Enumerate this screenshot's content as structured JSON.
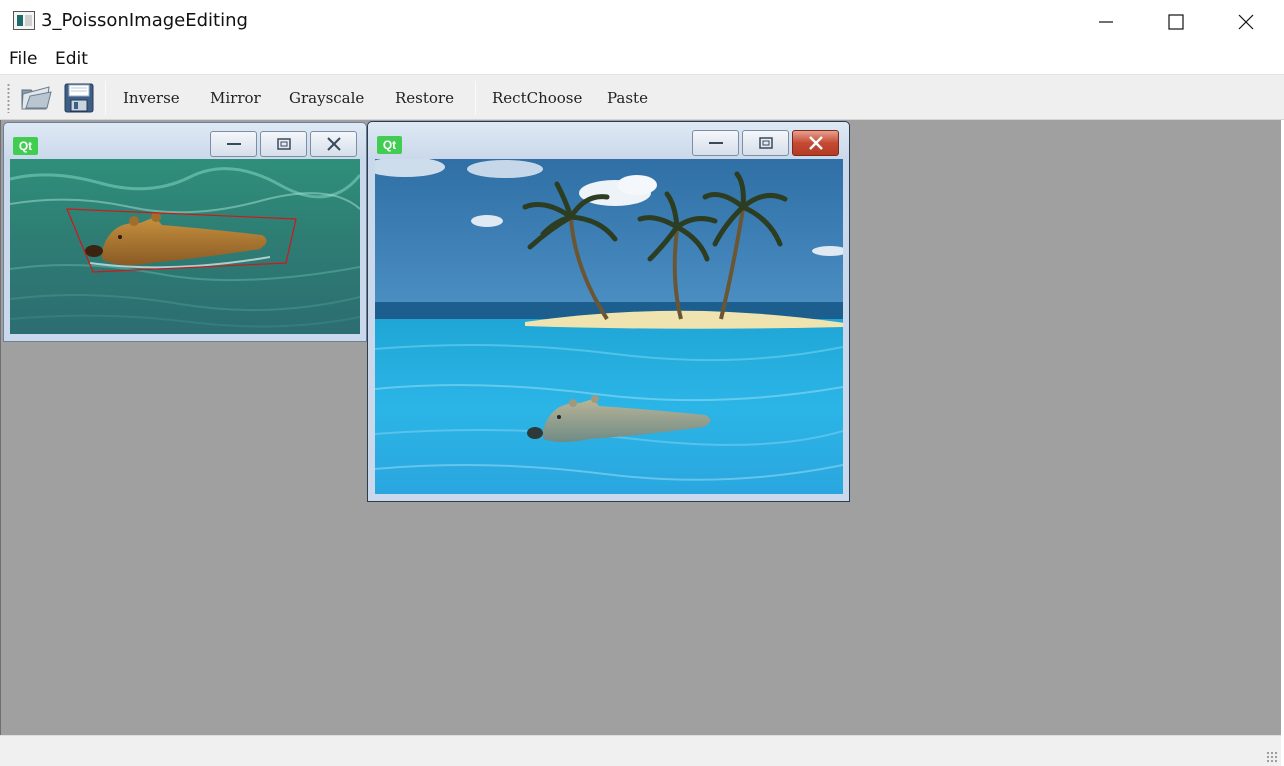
{
  "window": {
    "title": "3_PoissonImageEditing",
    "controls": {
      "minimize": "minimize-icon",
      "maximize": "maximize-icon",
      "close": "close-icon"
    }
  },
  "menubar": {
    "items": [
      {
        "label": "File"
      },
      {
        "label": "Edit"
      }
    ]
  },
  "toolbar": {
    "icons": [
      {
        "name": "open-folder-icon"
      },
      {
        "name": "save-disk-icon"
      }
    ],
    "actions": {
      "inverse": "Inverse",
      "mirror": "Mirror",
      "grayscale": "Grayscale",
      "restore": "Restore",
      "rect_choose": "RectChoose",
      "paste": "Paste"
    }
  },
  "sub_windows": [
    {
      "badge": "Qt",
      "image": "source image: bear swimming in green water with red polygon selection",
      "active": false
    },
    {
      "badge": "Qt",
      "image": "target image: tropical island with palm trees and pasted bear in blue water",
      "active": true
    }
  ],
  "colors": {
    "mdi_background": "#a0a0a0",
    "qt_green": "#41cd52",
    "selection_red": "#d01818",
    "close_button_red": "#c44a33"
  }
}
